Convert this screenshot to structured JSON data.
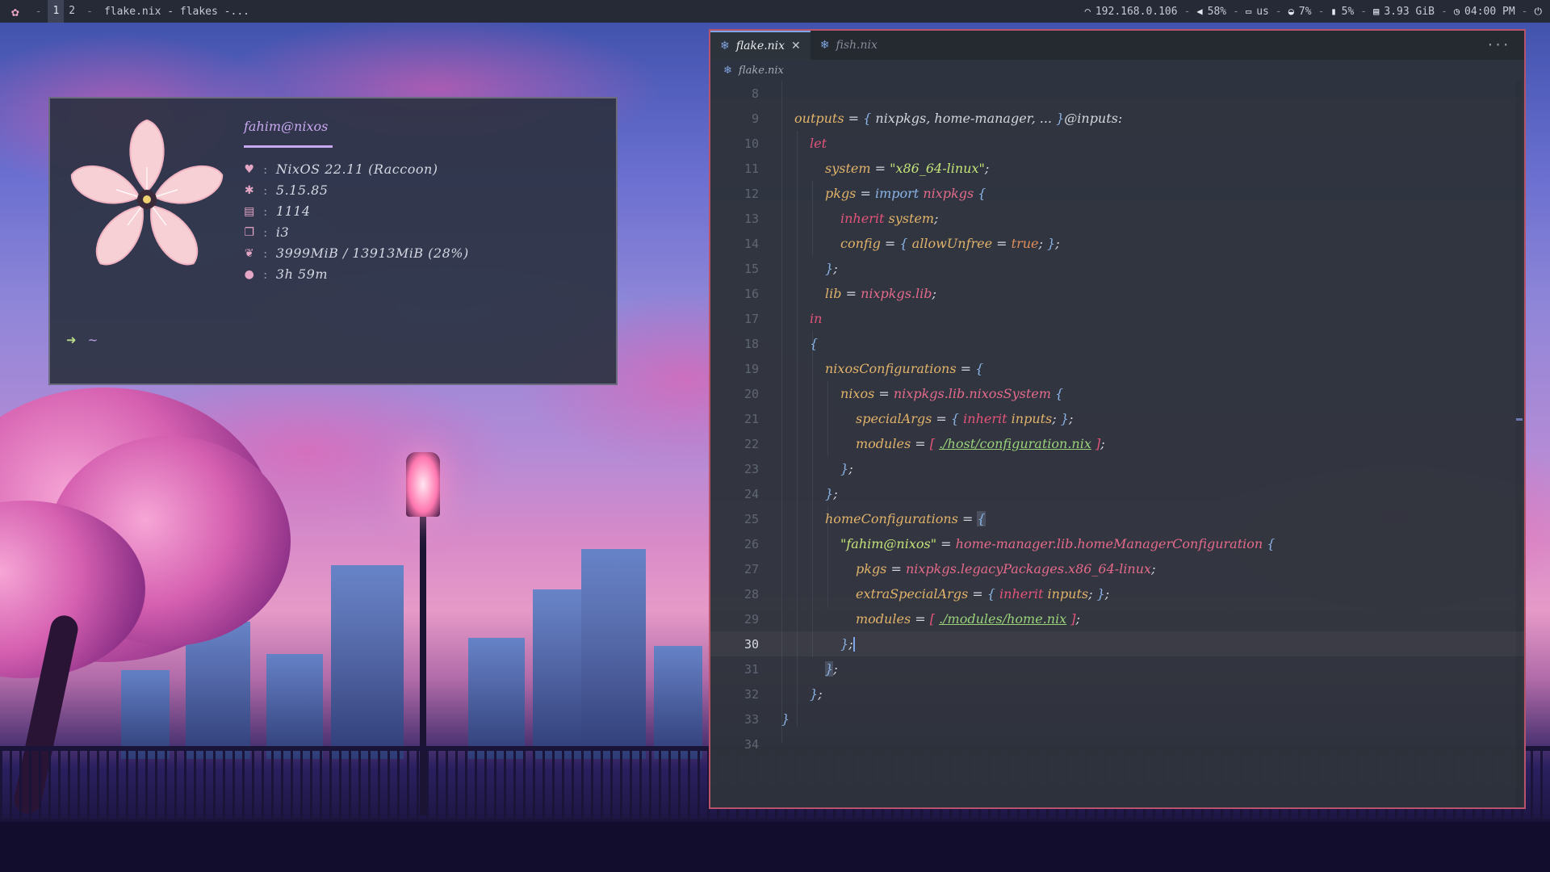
{
  "topbar": {
    "workspaces": [
      "1",
      "2"
    ],
    "window_title": "flake.nix - flakes -...",
    "status": {
      "ip": "192.168.0.106",
      "volume": "58%",
      "keyboard": "us",
      "cpu": "7%",
      "battery": "5%",
      "memory": "3.93 GiB",
      "time": "04:00 PM"
    }
  },
  "terminal": {
    "user": "fahim@nixos",
    "os": "NixOS 22.11 (Raccoon)",
    "kernel": "5.15.85",
    "packages": "1114",
    "wm": "i3",
    "memory": "3999MiB / 13913MiB (28%)",
    "uptime": "3h 59m",
    "prompt_arrow": "➜",
    "prompt_dir": "~"
  },
  "editor": {
    "tabs": [
      {
        "label": "flake.nix",
        "active": true
      },
      {
        "label": "fish.nix",
        "active": false
      }
    ],
    "breadcrumb": "flake.nix",
    "current_line": "30",
    "line_numbers": [
      "8",
      "9",
      "10",
      "11",
      "12",
      "13",
      "14",
      "15",
      "16",
      "17",
      "18",
      "19",
      "20",
      "21",
      "22",
      "23",
      "24",
      "25",
      "26",
      "27",
      "28",
      "29",
      "30",
      "31",
      "32",
      "33",
      "34"
    ]
  },
  "colors": {
    "accent_border": "#b8546a",
    "keyword": "#e4547a",
    "attribute": "#e2b36a",
    "string": "#c5e478"
  }
}
